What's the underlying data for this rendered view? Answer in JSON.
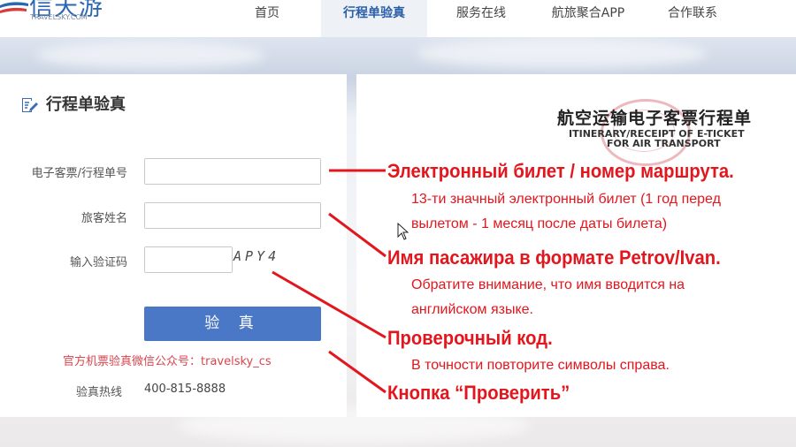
{
  "header": {
    "logo_text": "信天游",
    "logo_sub": "TRAVELSKY.COM",
    "nav": [
      {
        "label": "首页",
        "active": false
      },
      {
        "label": "行程单验真",
        "active": true
      },
      {
        "label": "服务在线",
        "active": false
      },
      {
        "label": "航旅聚合APP",
        "active": false
      },
      {
        "label": "合作联系",
        "active": false
      }
    ]
  },
  "form": {
    "title": "行程单验真",
    "ticket_label": "电子客票/行程单号",
    "ticket_value": "",
    "name_label": "旅客姓名",
    "name_value": "",
    "code_label": "输入验证码",
    "code_value": "",
    "captcha_text": "APY4",
    "submit_label": "验 真",
    "wechat_text": "官方机票验真微信公众号：travelsky_cs",
    "hotline_label": "验真热线",
    "hotline_value": "400-815-8888"
  },
  "receipt": {
    "title": "航空运输电子客票行程单",
    "subtitle_line1": "ITINERARY/RECEIPT OF E-TICKET",
    "subtitle_line2": "FOR AIR TRANSPORT"
  },
  "annotations": {
    "ticket_heading": "Электронный билет / номер маршрута.",
    "ticket_note1": "13-ти значный электронный билет (1 год перед",
    "ticket_note2": "вылетом - 1 месяц после даты билета)",
    "name_heading": "Имя пасажира в формате Petrov/Ivan.",
    "name_note1": "Обратите внимание, что имя вводится на",
    "name_note2": "английском языке.",
    "code_heading": "Проверочный код.",
    "code_note": "В точности повторите символы справа.",
    "button_heading": "Кнопка “Проверить”"
  },
  "colors": {
    "accent": "#4a78c6",
    "annotation": "#e3151d",
    "logo": "#2b66b3"
  }
}
